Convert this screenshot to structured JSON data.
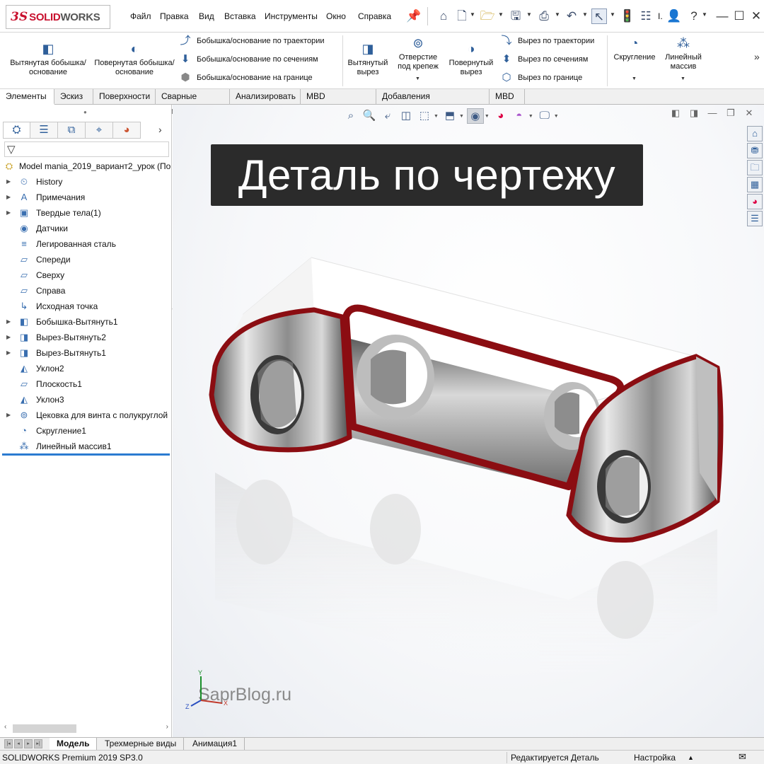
{
  "app": {
    "logo_ds": "3S",
    "logo_solid": "SOLID",
    "logo_works": "WORKS"
  },
  "menu": [
    "Файл",
    "Правка",
    "Вид",
    "Вставка",
    "Инструменты",
    "Окно",
    "Справка"
  ],
  "ribbon": {
    "extrude_boss": "Вытянутая бобышка/основание",
    "revolve_boss": "Повернутая бобышка/основание",
    "sweep_boss": "Бобышка/основание по траектории",
    "loft_boss": "Бобышка/основание по сечениям",
    "boundary_boss": "Бобышка/основание на границе",
    "extrude_cut": "Вытянутый вырез",
    "hole_wizard": "Отверстие под крепеж",
    "revolve_cut": "Повернутый вырез",
    "sweep_cut": "Вырез по траектории",
    "loft_cut": "Вырез по сечениям",
    "boundary_cut": "Вырез по границе",
    "fillet": "Скругление",
    "linear_pattern": "Линейный массив",
    "title_truncated": "I."
  },
  "tabs": [
    "Элементы",
    "Эскиз",
    "Поверхности",
    "Сварные детали",
    "Анализировать",
    "MBD Dimensions",
    "Добавления SOLIDWORKS",
    "MBD"
  ],
  "tree": {
    "root": "Model mania_2019_вариант2_урок (По",
    "items": [
      {
        "label": "History",
        "icon": "history-icon",
        "glyph": "⏲",
        "expand": true
      },
      {
        "label": "Примечания",
        "icon": "annotations-icon",
        "glyph": "A",
        "expand": true
      },
      {
        "label": "Твердые тела(1)",
        "icon": "solid-bodies-icon",
        "glyph": "▣",
        "expand": true
      },
      {
        "label": "Датчики",
        "icon": "sensors-icon",
        "glyph": "◉",
        "expand": false
      },
      {
        "label": "Легированная сталь",
        "icon": "material-icon",
        "glyph": "≡",
        "expand": false
      },
      {
        "label": "Спереди",
        "icon": "plane-icon",
        "glyph": "▱",
        "expand": false
      },
      {
        "label": "Сверху",
        "icon": "plane-icon",
        "glyph": "▱",
        "expand": false
      },
      {
        "label": "Справа",
        "icon": "plane-icon",
        "glyph": "▱",
        "expand": false
      },
      {
        "label": "Исходная точка",
        "icon": "origin-icon",
        "glyph": "↳",
        "expand": false
      },
      {
        "label": "Бобышка-Вытянуть1",
        "icon": "extrude-feature-icon",
        "glyph": "◧",
        "expand": true
      },
      {
        "label": "Вырез-Вытянуть2",
        "icon": "cut-feature-icon",
        "glyph": "◨",
        "expand": true
      },
      {
        "label": "Вырез-Вытянуть1",
        "icon": "cut-feature-icon",
        "glyph": "◨",
        "expand": true
      },
      {
        "label": "Уклон2",
        "icon": "draft-icon",
        "glyph": "◭",
        "expand": false
      },
      {
        "label": "Плоскость1",
        "icon": "plane-icon",
        "glyph": "▱",
        "expand": false
      },
      {
        "label": "Уклон3",
        "icon": "draft-icon",
        "glyph": "◭",
        "expand": false
      },
      {
        "label": "Цековка для  винта с полукруглой",
        "icon": "hole-feature-icon",
        "glyph": "⊚",
        "expand": true
      },
      {
        "label": "Скругление1",
        "icon": "fillet-feature-icon",
        "glyph": "◔",
        "expand": false
      },
      {
        "label": "Линейный массив1",
        "icon": "pattern-feature-icon",
        "glyph": "⁂",
        "expand": false
      }
    ]
  },
  "viewport": {
    "banner": "Деталь по чертежу",
    "watermark": "SaprBlog.ru",
    "axis_x": "X",
    "axis_y": "Y",
    "axis_z": "Z"
  },
  "bottom_tabs": [
    "Модель",
    "Трехмерные виды",
    "Анимация1"
  ],
  "status": {
    "product": "SOLIDWORKS Premium 2019 SP3.0",
    "mode": "Редактируется Деталь",
    "settings": "Настройка"
  },
  "colors": {
    "brand_red": "#c8102e",
    "edge_red": "#8b0d12",
    "rollback_blue": "#2b7bd1"
  }
}
